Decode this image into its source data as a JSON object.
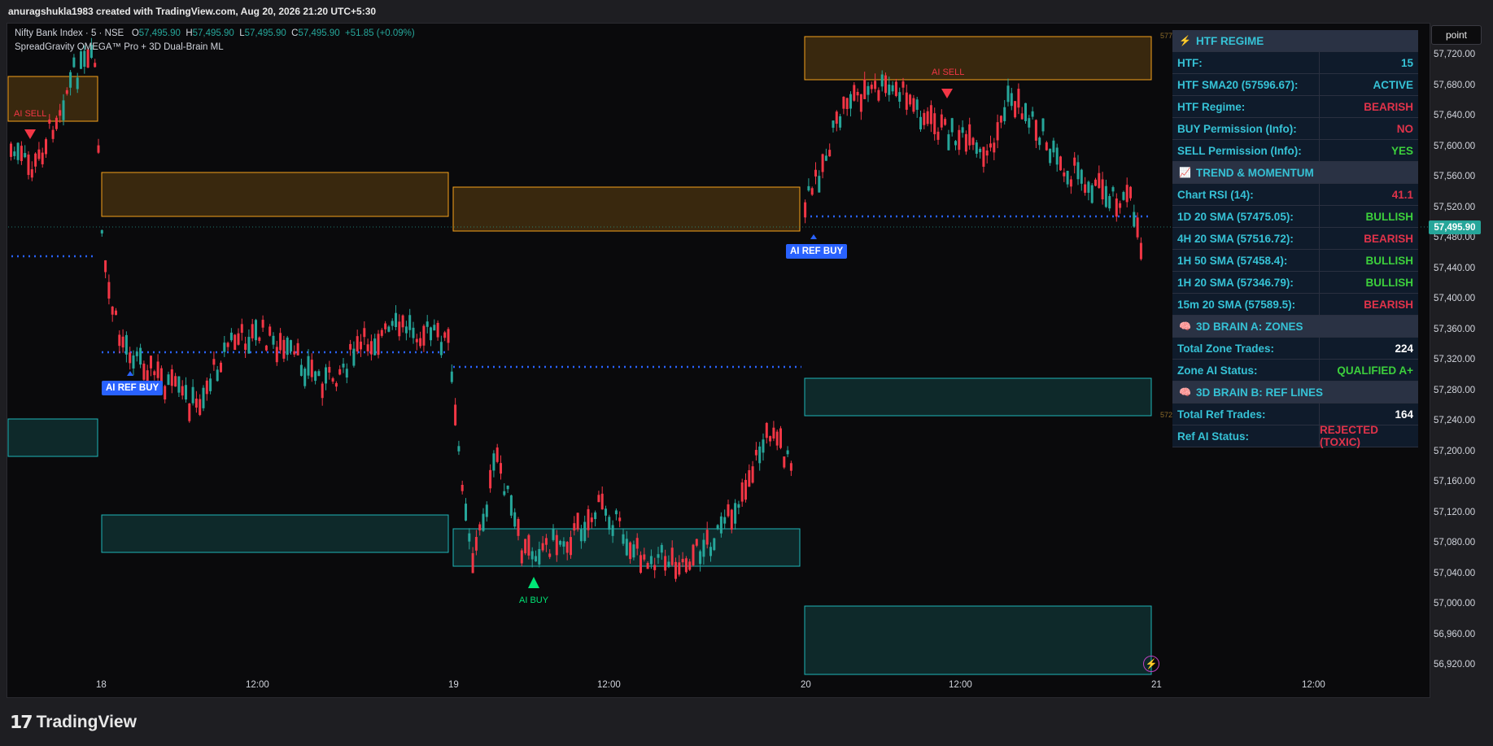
{
  "topbar": {
    "text": "anuragshukla1983 created with TradingView.com, Aug 20, 2026 21:20 UTC+5:30"
  },
  "legend": {
    "symbol": "Nifty Bank Index · 5 · NSE",
    "open_label": "O",
    "open": "57,495.90",
    "high_label": "H",
    "high": "57,495.90",
    "low_label": "L",
    "low": "57,495.90",
    "close_label": "C",
    "close": "57,495.90",
    "change": "+51.85 (+0.09%)",
    "indicator": "SpreadGravity OMEGA™ Pro + 3D Dual-Brain ML"
  },
  "scale_mode": "point",
  "current_price": "57,495.90",
  "y_axis": [
    "57,720.00",
    "57,680.00",
    "57,640.00",
    "57,600.00",
    "57,560.00",
    "57,520.00",
    "57,480.00",
    "57,440.00",
    "57,400.00",
    "57,360.00",
    "57,320.00",
    "57,280.00",
    "57,240.00",
    "57,200.00",
    "57,160.00",
    "57,120.00",
    "57,080.00",
    "57,040.00",
    "57,000.00",
    "56,960.00",
    "56,920.00"
  ],
  "x_axis": [
    "18",
    "12:00",
    "19",
    "12:00",
    "20",
    "12:00",
    "21",
    "12:00"
  ],
  "edge_labels": [
    "577",
    "572"
  ],
  "signals": {
    "ai_sell": "AI SELL",
    "ai_buy": "AI BUY",
    "ai_ref_buy": "AI REF BUY"
  },
  "panel": {
    "sections": [
      {
        "title": "HTF REGIME",
        "icon": "lightning-icon",
        "rows": [
          {
            "label": "HTF:",
            "value": "15",
            "color": "#36c2d6"
          },
          {
            "label": "HTF SMA20 (57596.67):",
            "value": "ACTIVE",
            "color": "#36c2d6"
          },
          {
            "label": "HTF Regime:",
            "value": "BEARISH",
            "color": "#e0334a"
          },
          {
            "label": "BUY Permission (Info):",
            "value": "NO",
            "color": "#e0334a"
          },
          {
            "label": "SELL Permission (Info):",
            "value": "YES",
            "color": "#3cd03c"
          }
        ]
      },
      {
        "title": "TREND & MOMENTUM",
        "icon": "chart-trend-icon",
        "rows": [
          {
            "label": "Chart RSI (14):",
            "value": "41.1",
            "color": "#e0334a"
          },
          {
            "label": "1D 20 SMA (57475.05):",
            "value": "BULLISH",
            "color": "#3cd03c"
          },
          {
            "label": "4H 20 SMA (57516.72):",
            "value": "BEARISH",
            "color": "#e0334a"
          },
          {
            "label": "1H 50 SMA (57458.4):",
            "value": "BULLISH",
            "color": "#3cd03c"
          },
          {
            "label": "1H 20 SMA (57346.79):",
            "value": "BULLISH",
            "color": "#3cd03c"
          },
          {
            "label": "15m 20 SMA (57589.5):",
            "value": "BEARISH",
            "color": "#e0334a"
          }
        ]
      },
      {
        "title": "3D BRAIN A: ZONES",
        "icon": "brain-icon",
        "rows": [
          {
            "label": "Total Zone Trades:",
            "value": "224",
            "color": "#ffffff"
          },
          {
            "label": "Zone AI Status:",
            "value": "QUALIFIED A+",
            "color": "#3cd03c"
          }
        ]
      },
      {
        "title": "3D BRAIN B: REF LINES",
        "icon": "brain-icon",
        "rows": [
          {
            "label": "Total Ref Trades:",
            "value": "164",
            "color": "#ffffff"
          },
          {
            "label": "Ref AI Status:",
            "value": "REJECTED (TOXIC)",
            "color": "#e0334a"
          }
        ]
      }
    ]
  },
  "brand": {
    "name": "TradingView"
  },
  "colors": {
    "up": "#26a69a",
    "down": "#f23645",
    "supply": "#f7a21b",
    "demand": "#1fb5b8",
    "ref_line": "#2962ff",
    "ai_sell": "#f23645",
    "ai_buy": "#00e676"
  }
}
